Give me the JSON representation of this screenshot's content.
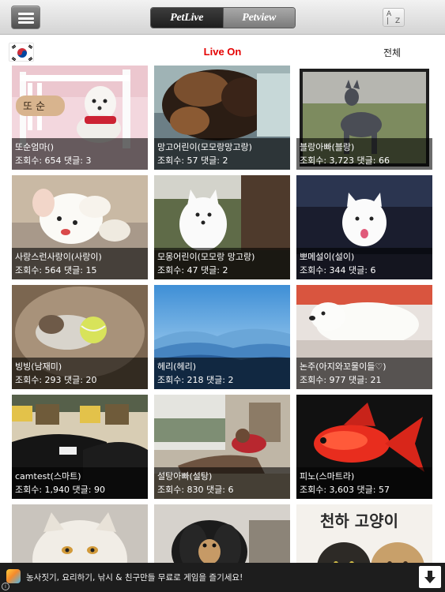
{
  "header": {
    "menu_icon": "hamburger-menu-icon",
    "tabs": [
      {
        "label": "PetLive",
        "active": true
      },
      {
        "label": "Petview",
        "active": false
      }
    ],
    "sort_icon": "sort-alphabetical-icon",
    "sort_letters": {
      "a": "A",
      "z": "Z"
    }
  },
  "subheader": {
    "country_flag": "korea-flag-icon",
    "title": "Live On",
    "title_color": "#e40000",
    "filter_label": "전체"
  },
  "pets": [
    {
      "name": "또순엄마()",
      "stats": "조회수: 654 댓글: 3"
    },
    {
      "name": "망고어린이(모모랑망고랑)",
      "stats": "조회수: 57 댓글: 2"
    },
    {
      "name": "블랑아빠(블랑)",
      "stats": "조회수: 3,723 댓글: 66"
    },
    {
      "name": "사랑스런사랑이(사랑이)",
      "stats": "조회수: 564 댓글: 15"
    },
    {
      "name": "모몽어린이(모모랑 망고랑)",
      "stats": "조회수: 47 댓글: 2"
    },
    {
      "name": "뽀메설이(설이)",
      "stats": "조회수: 344 댓글: 6"
    },
    {
      "name": "빙빙(남재미)",
      "stats": "조회수: 293 댓글: 20"
    },
    {
      "name": "헤리(헤리)",
      "stats": "조회수: 218 댓글: 2"
    },
    {
      "name": "논주(아지와꼬물이들♡)",
      "stats": "조회수: 977 댓글: 21"
    },
    {
      "name": "camtest(스마트)",
      "stats": "조회수: 1,940 댓글: 90"
    },
    {
      "name": "설탕아빠(설탕)",
      "stats": "조회수: 830 댓글: 6"
    },
    {
      "name": "피노(스마트라)",
      "stats": "조회수: 3,603 댓글: 57"
    },
    {
      "name": "",
      "stats": ""
    },
    {
      "name": "",
      "stats": ""
    },
    {
      "name": "",
      "stats": ""
    }
  ],
  "thumb_texts": {
    "sign": "또 순",
    "cat_title": "천하 고양이"
  },
  "ad": {
    "icon": "game-app-icon",
    "text": "농사짓기, 요리하기, 낚시 & 친구만들 무료로 게임을 즐기세요!",
    "download_icon": "download-arrow-icon",
    "info_icon": "info-icon",
    "info_glyph": "i"
  }
}
